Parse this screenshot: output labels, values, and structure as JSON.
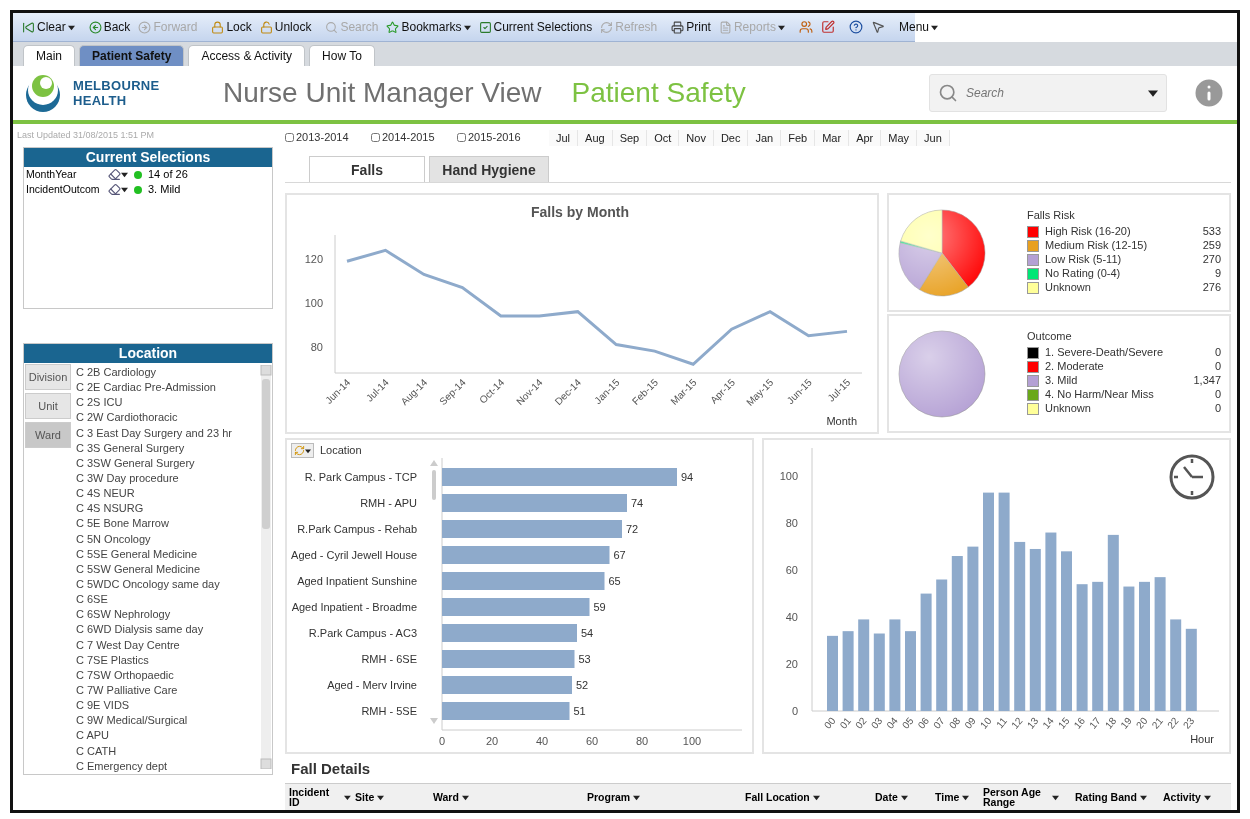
{
  "toolbar": {
    "buttons": [
      {
        "label": "Clear",
        "disabled": false,
        "dropdown": true
      },
      {
        "label": "Back",
        "disabled": false,
        "dropdown": false
      },
      {
        "label": "Forward",
        "disabled": true,
        "dropdown": false
      },
      {
        "label": "Lock",
        "disabled": false,
        "dropdown": false
      },
      {
        "label": "Unlock",
        "disabled": false,
        "dropdown": false
      },
      {
        "label": "Search",
        "disabled": true,
        "dropdown": false
      },
      {
        "label": "Bookmarks",
        "disabled": false,
        "dropdown": true
      },
      {
        "label": "Current Selections",
        "disabled": false,
        "dropdown": false
      },
      {
        "label": "Refresh",
        "disabled": true,
        "dropdown": false
      },
      {
        "label": "Print",
        "disabled": false,
        "dropdown": false
      },
      {
        "label": "Reports",
        "disabled": true,
        "dropdown": true
      }
    ],
    "menu": {
      "label": "Menu",
      "dropdown": true
    }
  },
  "tabs": [
    {
      "label": "Main",
      "selected": false
    },
    {
      "label": "Patient Safety",
      "selected": true
    },
    {
      "label": "Access & Activity",
      "selected": false
    },
    {
      "label": "How To",
      "selected": false
    }
  ],
  "header": {
    "logo_text": "MELBOURNE HEALTH",
    "title": "Nurse Unit Manager View",
    "subtitle": "Patient Safety",
    "search": {
      "placeholder": "Search"
    }
  },
  "last_updated": "Last Updated 31/08/2015  1:51 PM",
  "current_selections": {
    "title": "Current Selections",
    "rows": [
      {
        "field": "MonthYear",
        "value": "14 of 26"
      },
      {
        "field": "IncidentOutcom",
        "value": "3. Mild"
      }
    ]
  },
  "location": {
    "title": "Location",
    "levels": [
      {
        "label": "Division",
        "selected": false
      },
      {
        "label": "Unit",
        "selected": false
      },
      {
        "label": "Ward",
        "selected": true
      }
    ],
    "items": [
      "C 2B Cardiology",
      "C 2E Cardiac Pre-Admission",
      "C 2S ICU",
      "C 2W Cardiothoracic",
      "C 3 East Day Surgery and 23 hr",
      "C 3S General Surgery",
      "C 3SW General Surgery",
      "C 3W Day procedure",
      "C 4S NEUR",
      "C 4S NSURG",
      "C 5E Bone Marrow",
      "C 5N Oncology",
      "C 5SE General Medicine",
      "C 5SW General Medicine",
      "C 5WDC Oncology same day",
      "C 6SE",
      "C 6SW Nephrology",
      "C 6WD Dialysis same day",
      "C 7 West Day Centre",
      "C 7SE Plastics",
      "C 7SW Orthopaedic",
      "C 7W Palliative Care",
      "C 9E VIDS",
      "C 9W Medical/Surgical",
      "C APU",
      "C CATH",
      "C Emergency dept"
    ]
  },
  "years": [
    {
      "label": "2013-2014",
      "checked": false
    },
    {
      "label": "2014-2015",
      "checked": false
    },
    {
      "label": "2015-2016",
      "checked": false
    }
  ],
  "months": [
    "Jul",
    "Aug",
    "Sep",
    "Oct",
    "Nov",
    "Dec",
    "Jan",
    "Feb",
    "Mar",
    "Apr",
    "May",
    "Jun"
  ],
  "sub_tabs": [
    {
      "label": "Falls",
      "selected": true
    },
    {
      "label": "Hand Hygiene",
      "selected": false
    }
  ],
  "falls_by_month": {
    "chart_data": {
      "type": "line",
      "title": "Falls by Month",
      "xlabel": "Month",
      "categories": [
        "Jun-14",
        "Jul-14",
        "Aug-14",
        "Sep-14",
        "Oct-14",
        "Nov-14",
        "Dec-14",
        "Jan-15",
        "Feb-15",
        "Mar-15",
        "Apr-15",
        "May-15",
        "Jun-15",
        "Jul-15"
      ],
      "values": [
        119,
        124,
        113,
        107,
        94,
        94,
        96,
        81,
        78,
        72,
        88,
        96,
        85,
        87
      ],
      "yticks": [
        80,
        100,
        120
      ],
      "ylim": [
        68,
        131
      ]
    }
  },
  "falls_risk": {
    "chart_data": {
      "type": "pie",
      "title": "Falls Risk",
      "values": [
        39.57,
        19.23,
        20.04,
        0.67,
        20.49
      ]
    },
    "legend": [
      {
        "label": "High Risk (16-20)",
        "value": "533",
        "color": "#ff0000"
      },
      {
        "label": "Medium Risk (12-15)",
        "value": "259",
        "color": "#e8a020"
      },
      {
        "label": "Low Risk (5-11)",
        "value": "270",
        "color": "#b4a0d4"
      },
      {
        "label": "No Rating (0-4)",
        "value": "9",
        "color": "#00e676"
      },
      {
        "label": "Unknown",
        "value": "276",
        "color": "#ffff99"
      }
    ]
  },
  "outcome": {
    "chart_data": {
      "type": "pie",
      "title": "Outcome",
      "values": [
        0,
        0,
        100,
        0,
        0
      ]
    },
    "legend": [
      {
        "label": "1. Severe-Death/Severe",
        "value": "0",
        "color": "#000000"
      },
      {
        "label": "2. Moderate",
        "value": "0",
        "color": "#ff0000"
      },
      {
        "label": "3. Mild",
        "value": "1,347",
        "color": "#b4a0d4"
      },
      {
        "label": "4. No Harm/Near Miss",
        "value": "0",
        "color": "#6aa81a"
      },
      {
        "label": "Unknown",
        "value": "0",
        "color": "#ffff99"
      }
    ]
  },
  "by_location": {
    "title": "Location",
    "chart_data": {
      "type": "bar",
      "orientation": "horizontal",
      "categories": [
        "R. Park Campus - TCP",
        "RMH - APU",
        "R.Park Campus - Rehab",
        "Aged - Cyril Jewell House",
        "Aged Inpatient Sunshine",
        "Aged Inpatient - Broadme",
        "R.Park Campus - AC3",
        "RMH - 6SE",
        "Aged - Merv Irvine",
        "RMH - 5SE"
      ],
      "values": [
        94,
        74,
        72,
        67,
        65,
        59,
        54,
        53,
        52,
        51
      ],
      "xticks": [
        0,
        20,
        40,
        60,
        80,
        100
      ],
      "xlim": [
        0,
        120
      ],
      "data_labels": true
    }
  },
  "by_hour": {
    "chart_data": {
      "type": "bar",
      "xlabel": "Hour",
      "categories": [
        "00",
        "01",
        "02",
        "03",
        "04",
        "05",
        "06",
        "07",
        "08",
        "09",
        "10",
        "11",
        "12",
        "13",
        "14",
        "15",
        "16",
        "17",
        "18",
        "19",
        "20",
        "21",
        "22",
        "23"
      ],
      "values": [
        32,
        34,
        39,
        33,
        39,
        34,
        50,
        56,
        66,
        70,
        93,
        93,
        72,
        69,
        76,
        68,
        54,
        55,
        75,
        53,
        55,
        57,
        39,
        35
      ],
      "yticks": [
        0,
        20,
        40,
        60,
        80,
        100
      ],
      "ylim": [
        0,
        112
      ]
    }
  },
  "fall_details": {
    "title": "Fall Details",
    "columns": [
      "Incident ID",
      "Site",
      "Ward",
      "Program",
      "Fall Location",
      "Date",
      "Time",
      "Person Age Range",
      "Rating Band",
      "Activity"
    ]
  }
}
